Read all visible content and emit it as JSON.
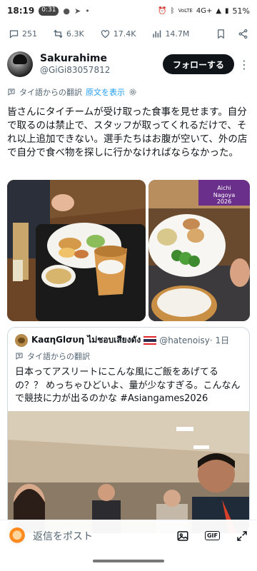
{
  "status": {
    "time": "18:19",
    "pill": "0:31",
    "network": "4G+",
    "battery": "51%"
  },
  "actions": {
    "replies": "251",
    "reposts": "6.3K",
    "likes": "17.4K",
    "views": "14.7M"
  },
  "author": {
    "display_name": "Sakurahime",
    "handle": "@GiGi83057812",
    "follow_label": "フォローする"
  },
  "translation": {
    "label": "タイ語からの翻訳",
    "show_original": "原文を表示"
  },
  "tweet": {
    "text": "皆さんにタイチームが受け取った食事を見せます。自分で取るのは禁止で、スタッフが取ってくれるだけで、それ以上追加できない。選手たちはお腹が空いて、外の店で自分で食べ物を探しに行かなければならなかった。"
  },
  "photos": {
    "banner_text": "Aichi Nagoya 2026"
  },
  "quote": {
    "name": "KaαηGlσυη ไม่ชอบเสียงดัง",
    "handle": "@hatenoisy",
    "time": "· 1日",
    "translation_label": "タイ語からの翻訳",
    "text": "日本ってアスリートにこんな風にご飯をあげてるの？？ めっちゃひどいよ、量が少なすぎる。こんなんで競技に力が出るのかな #Asiangames2026"
  },
  "reply": {
    "placeholder": "返信をポスト"
  },
  "colors": {
    "link": "#1d9bf0",
    "follow_bg": "#0f1419",
    "muted": "#536471"
  }
}
